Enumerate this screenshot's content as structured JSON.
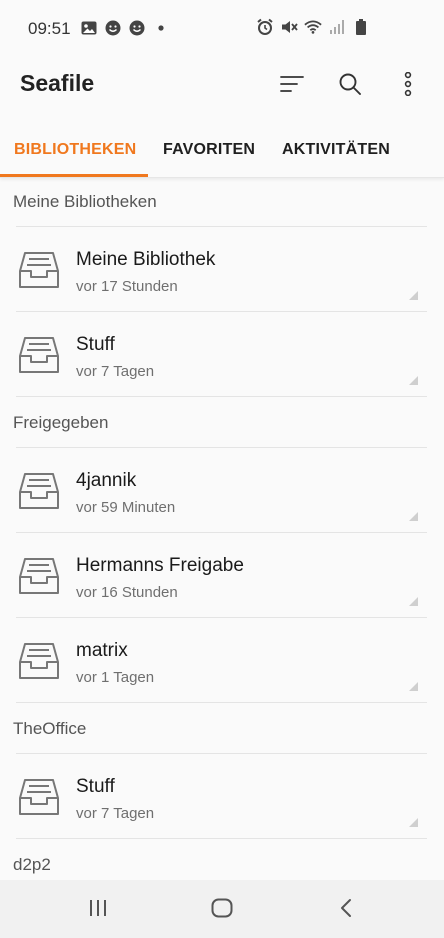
{
  "status": {
    "time": "09:51",
    "left_icons": [
      "image-icon",
      "smiley-icon",
      "smiley-icon",
      "dot-icon"
    ],
    "right_icons": [
      "alarm-icon",
      "mute-icon",
      "wifi-icon",
      "signal-icon",
      "battery-icon"
    ]
  },
  "app": {
    "title": "Seafile",
    "actions": [
      "sort-icon",
      "search-icon",
      "more-vert-icon"
    ]
  },
  "tabs": [
    {
      "label": "BIBLIOTHEKEN",
      "active": true
    },
    {
      "label": "FAVORITEN",
      "active": false
    },
    {
      "label": "AKTIVITÄTEN",
      "active": false
    }
  ],
  "sections": [
    {
      "header": "Meine Bibliotheken",
      "items": [
        {
          "title": "Meine Bibliothek",
          "subtitle": "vor 17 Stunden"
        },
        {
          "title": "Stuff",
          "subtitle": "vor 7 Tagen"
        }
      ]
    },
    {
      "header": "Freigegeben",
      "items": [
        {
          "title": "4jannik",
          "subtitle": "vor 59 Minuten"
        },
        {
          "title": "Hermanns Freigabe",
          "subtitle": "vor 16 Stunden"
        },
        {
          "title": "matrix",
          "subtitle": "vor 1 Tagen"
        }
      ]
    },
    {
      "header": "TheOffice",
      "items": [
        {
          "title": "Stuff",
          "subtitle": "vor 7 Tagen"
        }
      ]
    },
    {
      "header": "d2p2",
      "items": []
    }
  ],
  "colors": {
    "accent": "#f0781e",
    "text": "#1a1a1a",
    "muted": "#6f6f6f"
  },
  "nav": [
    "recent-apps-icon",
    "home-icon",
    "back-icon"
  ]
}
